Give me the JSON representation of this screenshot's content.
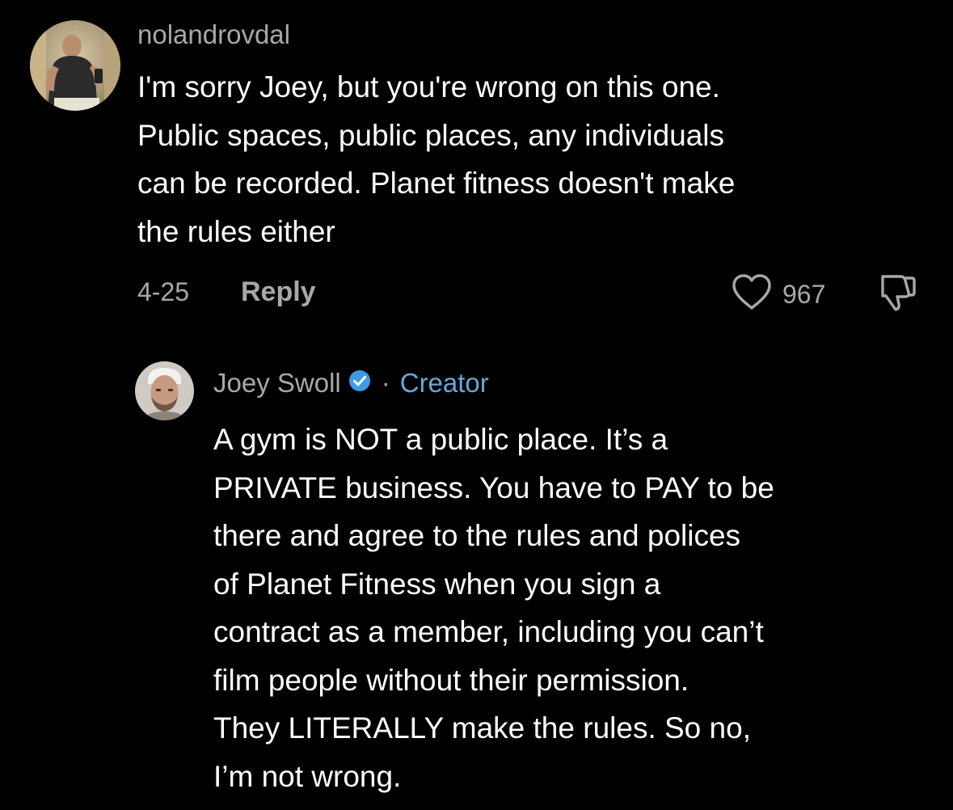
{
  "comment": {
    "username": "nolandrovdal",
    "text": "I'm sorry Joey, but you're wrong on this one.\nPublic spaces, public places, any individuals\ncan be recorded. Planet fitness doesn't make\nthe rules either",
    "date": "4-25",
    "reply_label": "Reply",
    "like_count": "967",
    "avatar_icon": "user-photo-icon"
  },
  "reply": {
    "username": "Joey Swoll",
    "verified_icon": "verified-badge-icon",
    "separator": "·",
    "role_label": "Creator",
    "text": "A gym is NOT a public place. It’s a\nPRIVATE business. You have to PAY to be\nthere and agree to the rules and polices\nof Planet Fitness when you sign a\ncontract as a member, including you can’t\nfilm people without their permission.\nThey LITERALLY make the rules. So no,\nI’m not wrong.",
    "avatar_icon": "user-photo-icon"
  },
  "colors": {
    "background": "#000000",
    "text": "#ffffff",
    "muted": "#a8a8a8",
    "creator": "#66a8d8",
    "verified": "#3d9be9"
  }
}
